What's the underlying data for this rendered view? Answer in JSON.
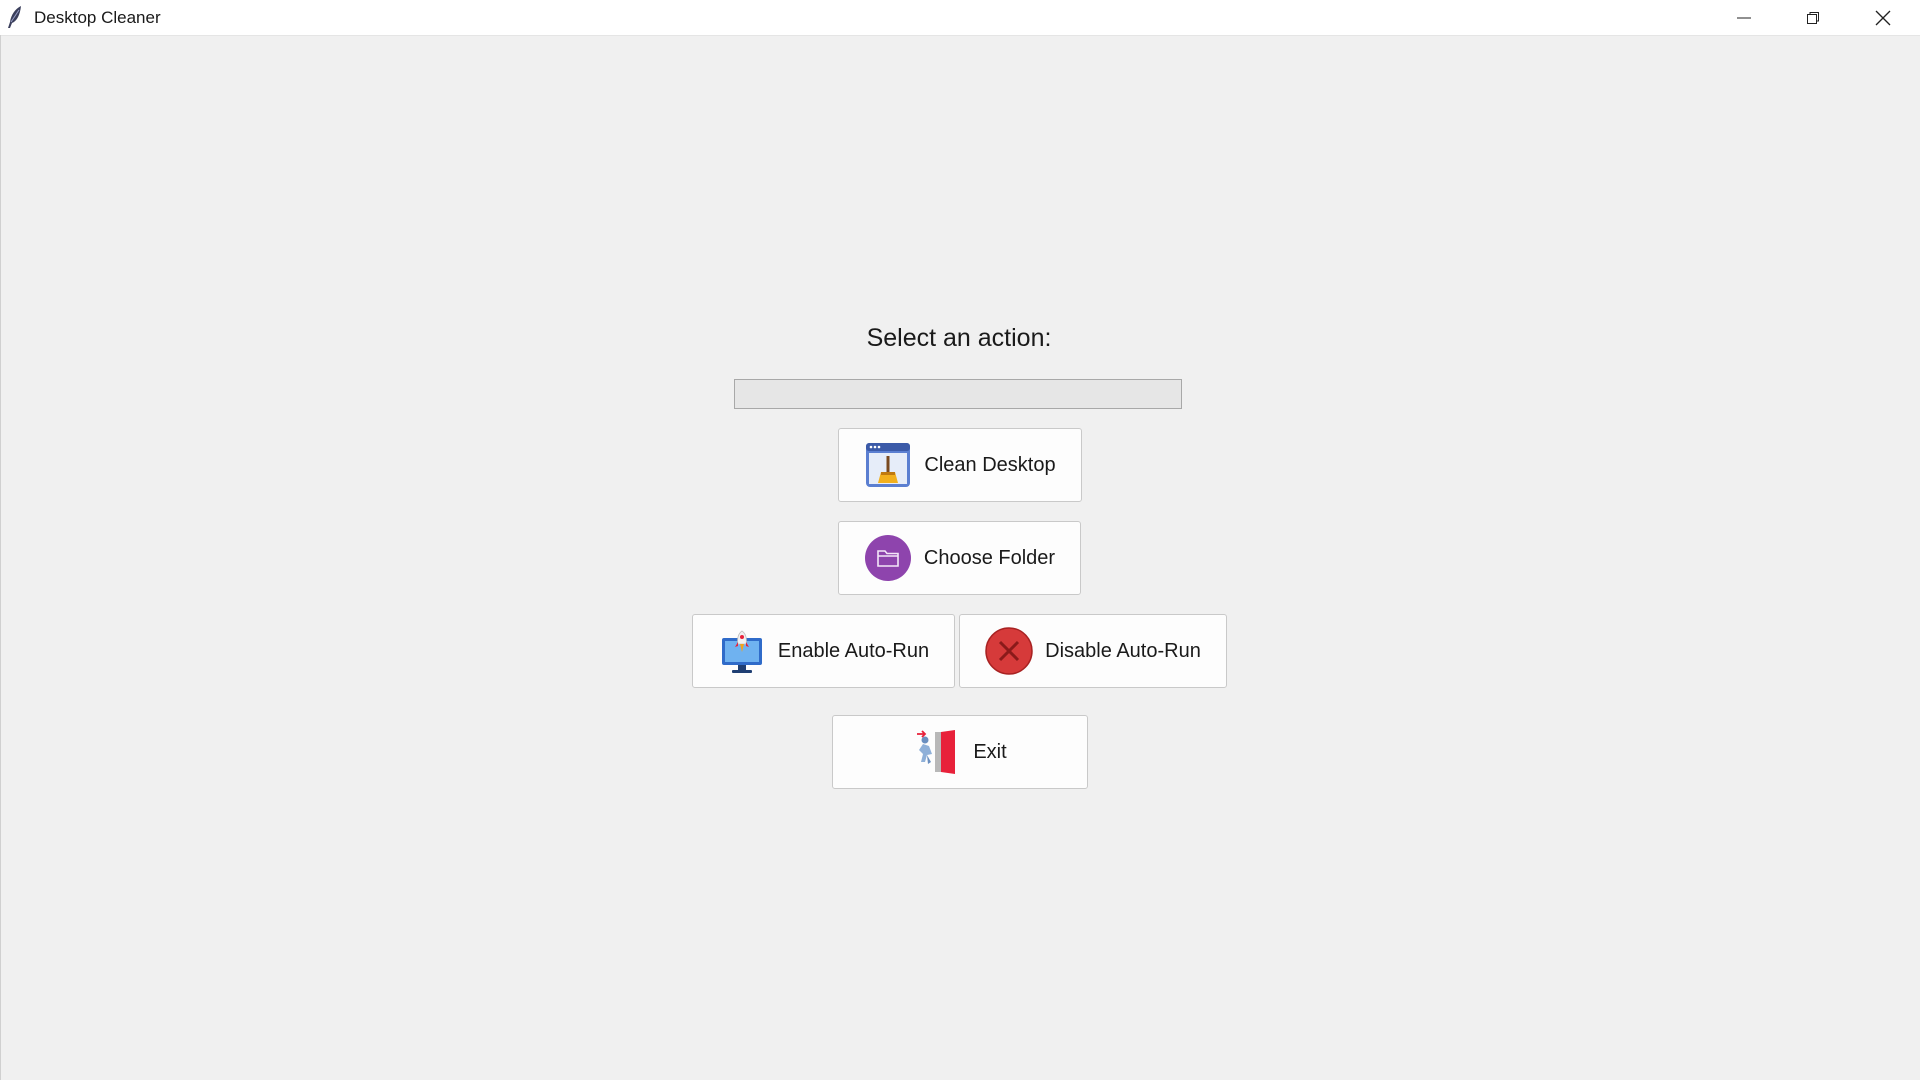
{
  "window": {
    "title": "Desktop Cleaner",
    "icon": "feather-icon",
    "controls": {
      "minimize_icon": "minimize-icon",
      "maximize_icon": "restore-icon",
      "close_icon": "close-icon"
    }
  },
  "main": {
    "prompt": "Select an action:",
    "status_value": ""
  },
  "buttons": {
    "clean": {
      "label": "Clean Desktop",
      "icon": "broom-window-icon"
    },
    "choose_folder": {
      "label": "Choose Folder",
      "icon": "folder-circle-icon"
    },
    "enable_autorun": {
      "label": "Enable Auto-Run",
      "icon": "monitor-rocket-icon"
    },
    "disable_autorun": {
      "label": "Disable Auto-Run",
      "icon": "red-x-circle-icon"
    },
    "exit": {
      "label": "Exit",
      "icon": "exit-door-icon"
    }
  },
  "colors": {
    "background": "#f0f0f0",
    "titlebar": "#ffffff",
    "button_face": "#fdfdfd",
    "folder_purple": "#8e44ad",
    "disable_red": "#d63a3a",
    "exit_red": "#e8213a"
  }
}
